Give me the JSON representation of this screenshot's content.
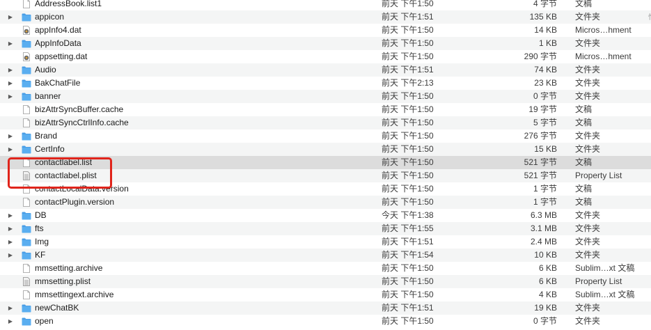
{
  "files": [
    {
      "name": "AddressBook.list1",
      "date": "前天 下午1:50",
      "size": "4 字节",
      "kind": "文稿",
      "type": "doc",
      "expandable": false
    },
    {
      "name": "appicon",
      "date": "前天 下午1:51",
      "size": "135 KB",
      "kind": "文件夹",
      "type": "folder",
      "expandable": true
    },
    {
      "name": "appInfo4.dat",
      "date": "前天 下午1:50",
      "size": "14 KB",
      "kind": "Micros…hment",
      "type": "dat",
      "expandable": false
    },
    {
      "name": "AppInfoData",
      "date": "前天 下午1:50",
      "size": "1 KB",
      "kind": "文件夹",
      "type": "folder",
      "expandable": true
    },
    {
      "name": "appsetting.dat",
      "date": "前天 下午1:50",
      "size": "290 字节",
      "kind": "Micros…hment",
      "type": "dat",
      "expandable": false
    },
    {
      "name": "Audio",
      "date": "前天 下午1:51",
      "size": "74 KB",
      "kind": "文件夹",
      "type": "folder",
      "expandable": true
    },
    {
      "name": "BakChatFile",
      "date": "前天 下午2:13",
      "size": "23 KB",
      "kind": "文件夹",
      "type": "folder",
      "expandable": true
    },
    {
      "name": "banner",
      "date": "前天 下午1:50",
      "size": "0 字节",
      "kind": "文件夹",
      "type": "folder",
      "expandable": true
    },
    {
      "name": "bizAttrSyncBuffer.cache",
      "date": "前天 下午1:50",
      "size": "19 字节",
      "kind": "文稿",
      "type": "doc",
      "expandable": false
    },
    {
      "name": "bizAttrSyncCtrlInfo.cache",
      "date": "前天 下午1:50",
      "size": "5 字节",
      "kind": "文稿",
      "type": "doc",
      "expandable": false
    },
    {
      "name": "Brand",
      "date": "前天 下午1:50",
      "size": "276 字节",
      "kind": "文件夹",
      "type": "folder",
      "expandable": true
    },
    {
      "name": "CertInfo",
      "date": "前天 下午1:50",
      "size": "15 KB",
      "kind": "文件夹",
      "type": "folder",
      "expandable": true
    },
    {
      "name": "contactlabel.list",
      "date": "前天 下午1:50",
      "size": "521 字节",
      "kind": "文稿",
      "type": "doc",
      "expandable": false,
      "selected": true
    },
    {
      "name": "contactlabel.plist",
      "date": "前天 下午1:50",
      "size": "521 字节",
      "kind": "Property List",
      "type": "plist",
      "expandable": false
    },
    {
      "name": "contactLocalData.version",
      "date": "前天 下午1:50",
      "size": "1 字节",
      "kind": "文稿",
      "type": "doc",
      "expandable": false
    },
    {
      "name": "contactPlugin.version",
      "date": "前天 下午1:50",
      "size": "1 字节",
      "kind": "文稿",
      "type": "doc",
      "expandable": false
    },
    {
      "name": "DB",
      "date": "今天 下午1:38",
      "size": "6.3 MB",
      "kind": "文件夹",
      "type": "folder",
      "expandable": true
    },
    {
      "name": "fts",
      "date": "前天 下午1:55",
      "size": "3.1 MB",
      "kind": "文件夹",
      "type": "folder",
      "expandable": true
    },
    {
      "name": "Img",
      "date": "前天 下午1:51",
      "size": "2.4 MB",
      "kind": "文件夹",
      "type": "folder",
      "expandable": true
    },
    {
      "name": "KF",
      "date": "前天 下午1:54",
      "size": "10 KB",
      "kind": "文件夹",
      "type": "folder",
      "expandable": true
    },
    {
      "name": "mmsetting.archive",
      "date": "前天 下午1:50",
      "size": "6 KB",
      "kind": "Sublim…xt 文稿",
      "type": "doc",
      "expandable": false
    },
    {
      "name": "mmsetting.plist",
      "date": "前天 下午1:50",
      "size": "6 KB",
      "kind": "Property List",
      "type": "plist",
      "expandable": false
    },
    {
      "name": "mmsettingext.archive",
      "date": "前天 下午1:50",
      "size": "4 KB",
      "kind": "Sublim…xt 文稿",
      "type": "doc",
      "expandable": false
    },
    {
      "name": "newChatBK",
      "date": "前天 下午1:51",
      "size": "19 KB",
      "kind": "文件夹",
      "type": "folder",
      "expandable": true
    },
    {
      "name": "open",
      "date": "前天 下午1:50",
      "size": "0 字节",
      "kind": "文件夹",
      "type": "folder",
      "expandable": true
    }
  ],
  "right_edge_text": "怕",
  "colors": {
    "folder": "#5aaef0",
    "folder_tab": "#4a9ee6",
    "highlight": "#e0241b",
    "selected_row": "#dcdcdc"
  }
}
